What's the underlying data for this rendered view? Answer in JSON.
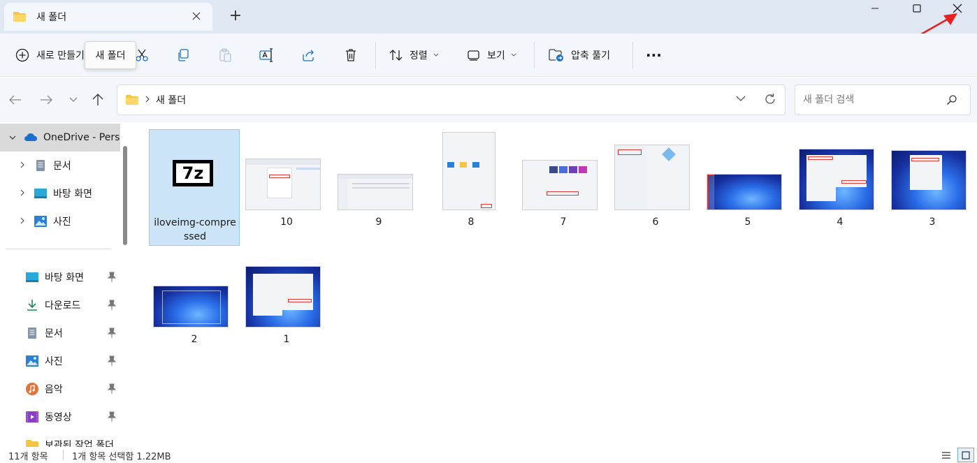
{
  "window": {
    "tab_title": "새 폴더",
    "new_tab_symbol": "+",
    "accent_color": "#0067c0"
  },
  "toolbar": {
    "new_label": "새로 만들기",
    "sort_label": "정렬",
    "view_label": "보기",
    "extract_label": "압축 풀기",
    "more_label": "···",
    "tooltip": "새 폴더",
    "icons": [
      "plus-circle-icon",
      "cut-icon",
      "copy-icon",
      "paste-icon",
      "rename-icon",
      "share-icon",
      "delete-icon",
      "sort-icon",
      "view-icon",
      "extract-icon",
      "more-icon"
    ]
  },
  "address": {
    "path": [
      "새 폴더"
    ],
    "search_placeholder": "새 폴더 검색"
  },
  "sidebar": {
    "tree": [
      {
        "label": "OneDrive - Pers",
        "icon": "cloud-icon",
        "expanded": true
      },
      {
        "label": "문서",
        "icon": "document-icon"
      },
      {
        "label": "바탕 화면",
        "icon": "desktop-icon"
      },
      {
        "label": "사진",
        "icon": "pictures-icon"
      }
    ],
    "quick": [
      {
        "label": "바탕 화면",
        "icon": "desktop-icon"
      },
      {
        "label": "다운로드",
        "icon": "download-icon"
      },
      {
        "label": "문서",
        "icon": "document-icon"
      },
      {
        "label": "사진",
        "icon": "pictures-icon"
      },
      {
        "label": "음악",
        "icon": "music-icon"
      },
      {
        "label": "동영상",
        "icon": "video-icon"
      },
      {
        "label": "보관된 작업 폴더",
        "icon": "folder-icon"
      }
    ]
  },
  "files": [
    {
      "name": "iloveimg-compressed",
      "line1": "iloveimg-compre",
      "line2": "ssed",
      "type": "7z",
      "selected": true
    },
    {
      "name": "10"
    },
    {
      "name": "9"
    },
    {
      "name": "8"
    },
    {
      "name": "7"
    },
    {
      "name": "6"
    },
    {
      "name": "5"
    },
    {
      "name": "4"
    },
    {
      "name": "3"
    },
    {
      "name": "2"
    },
    {
      "name": "1"
    }
  ],
  "archive_badge": "7z",
  "status": {
    "count": "11개 항목",
    "selection": "1개 항목 선택함 1.22MB"
  }
}
